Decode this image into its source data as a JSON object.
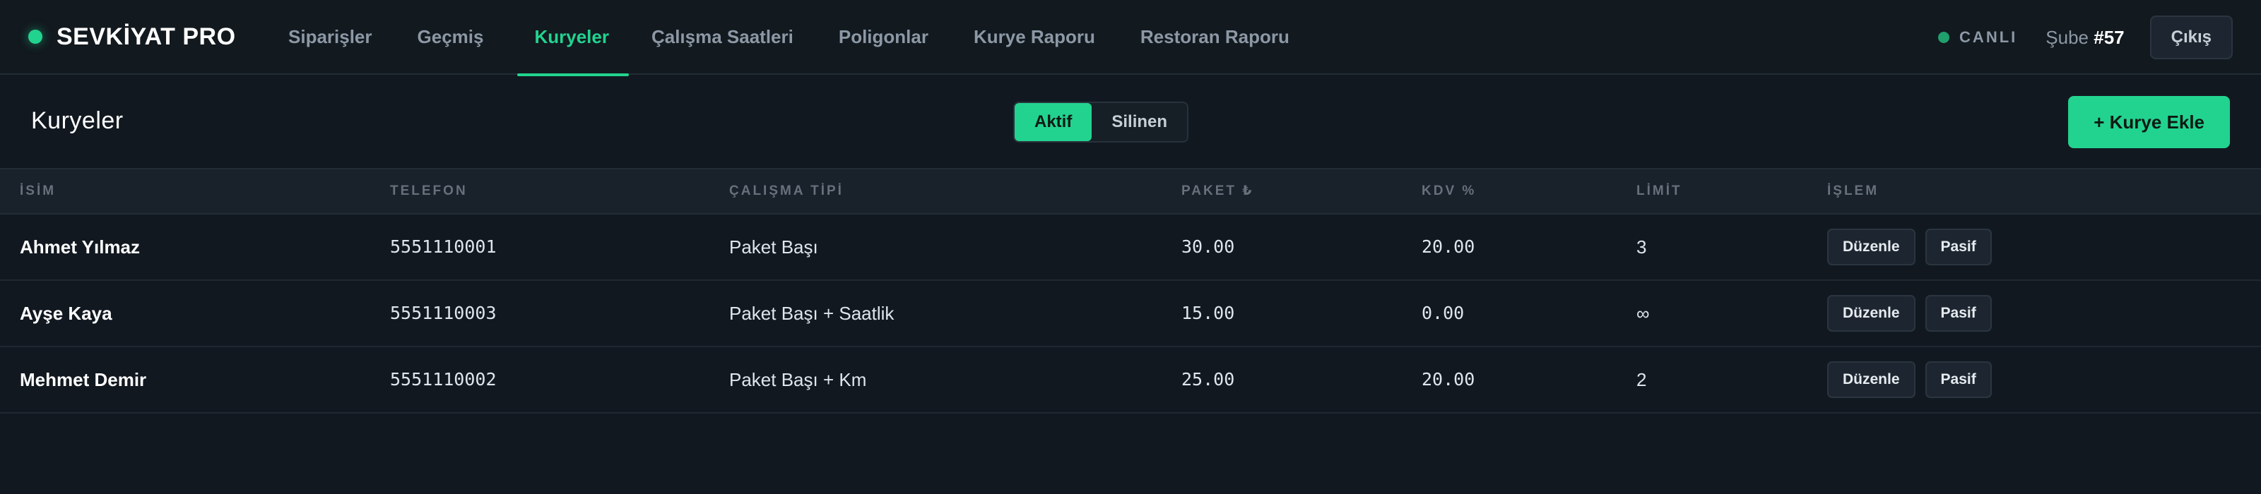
{
  "brand": {
    "name": "SEVKİYAT PRO"
  },
  "nav": {
    "items": [
      {
        "label": "Siparişler"
      },
      {
        "label": "Geçmiş"
      },
      {
        "label": "Kuryeler",
        "active": true
      },
      {
        "label": "Çalışma Saatleri"
      },
      {
        "label": "Poligonlar"
      },
      {
        "label": "Kurye Raporu"
      },
      {
        "label": "Restoran Raporu"
      }
    ]
  },
  "status": {
    "live_label": "CANLI",
    "branch_prefix": "Şube",
    "branch_number": "#57"
  },
  "header": {
    "logout_label": "Çıkış"
  },
  "page": {
    "title": "Kuryeler",
    "filter": {
      "active_label": "Aktif",
      "deleted_label": "Silinen"
    },
    "add_label": "+ Kurye Ekle"
  },
  "table": {
    "columns": [
      "İSİM",
      "TELEFON",
      "ÇALIŞMA TİPİ",
      "PAKET ₺",
      "KDV %",
      "LİMİT",
      "İŞLEM"
    ],
    "rows": [
      {
        "name": "Ahmet Yılmaz",
        "phone": "5551110001",
        "work_type": "Paket Başı",
        "package_fee": "30.00",
        "vat": "20.00",
        "limit": "3",
        "edit_label": "Düzenle",
        "passive_label": "Pasif"
      },
      {
        "name": "Ayşe Kaya",
        "phone": "5551110003",
        "work_type": "Paket Başı + Saatlik",
        "package_fee": "15.00",
        "vat": "0.00",
        "limit": "∞",
        "edit_label": "Düzenle",
        "passive_label": "Pasif"
      },
      {
        "name": "Mehmet Demir",
        "phone": "5551110002",
        "work_type": "Paket Başı + Km",
        "package_fee": "25.00",
        "vat": "20.00",
        "limit": "2",
        "edit_label": "Düzenle",
        "passive_label": "Pasif"
      }
    ]
  },
  "colors": {
    "accent": "#22d38f",
    "background": "#111820",
    "muted": "#8c98a5"
  }
}
